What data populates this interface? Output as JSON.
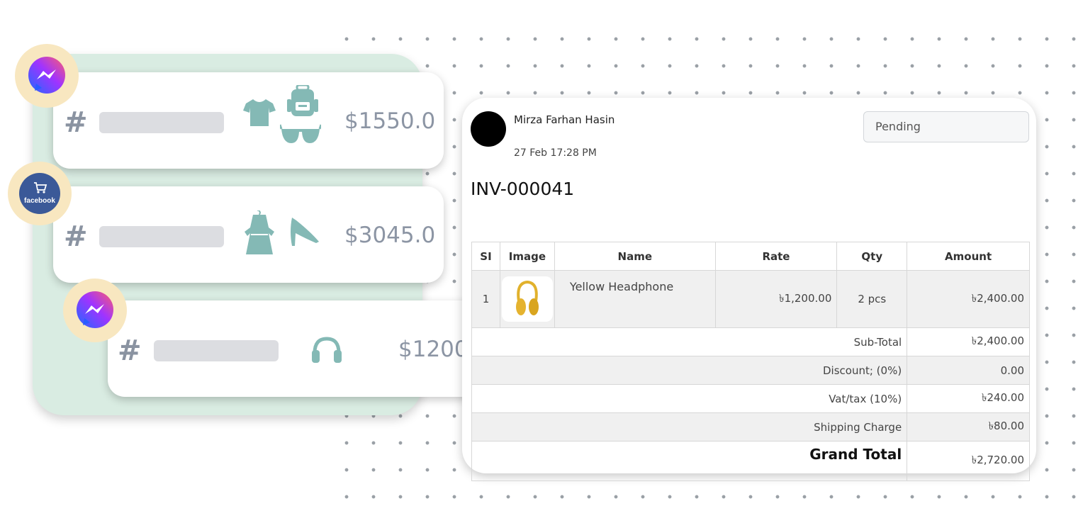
{
  "orders": [
    {
      "price": "$1550.0",
      "channel": "messenger",
      "products": [
        "tshirt-icon",
        "backpack-icon",
        "sunglasses-icon"
      ]
    },
    {
      "price": "$3045.0",
      "channel": "facebook",
      "channel_label": "facebook",
      "products": [
        "dress-icon",
        "high-heel-icon"
      ]
    },
    {
      "price": "$1200.0",
      "channel": "messenger",
      "products": [
        "headphones-icon"
      ]
    }
  ],
  "colors": {
    "accent": "#84b9b5",
    "panel": "#d9ece2",
    "badge_ring": "#f8e7c0",
    "facebook": "#3b5998"
  },
  "invoice": {
    "customer_name": "Mirza Farhan Hasin",
    "date": "27 Feb 17:28 PM",
    "status": "Pending",
    "number": "INV-000041",
    "headers": {
      "si": "SI",
      "image": "Image",
      "name": "Name",
      "rate": "Rate",
      "qty": "Qty",
      "amount": "Amount"
    },
    "items": [
      {
        "si": "1",
        "name": "Yellow Headphone",
        "rate": "৳1,200.00",
        "qty": "2 pcs",
        "amount": "৳2,400.00"
      }
    ],
    "summary": {
      "subtotal_label": "Sub-Total",
      "subtotal": "৳2,400.00",
      "discount_label": "Discount; (0%)",
      "discount": "0.00",
      "vat_label": "Vat/tax (10%)",
      "vat": "৳240.00",
      "shipping_label": "Shipping Charge",
      "shipping": "৳80.00",
      "grand_label": "Grand Total",
      "grand": "৳2,720.00"
    }
  }
}
